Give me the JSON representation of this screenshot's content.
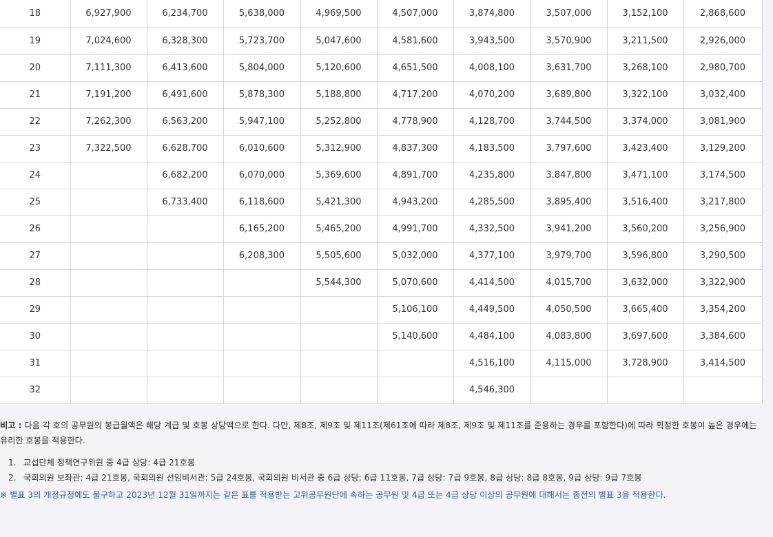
{
  "table": {
    "rows": [
      [
        "18",
        "6,927,900",
        "6,234,700",
        "5,638,000",
        "4,969,500",
        "4,507,000",
        "3,874,800",
        "3,507,000",
        "3,152,100",
        "2,868,600"
      ],
      [
        "19",
        "7,024,600",
        "6,328,300",
        "5,723,700",
        "5,047,600",
        "4,581,600",
        "3,943,500",
        "3,570,900",
        "3,211,500",
        "2,926,000"
      ],
      [
        "20",
        "7,111,300",
        "6,413,600",
        "5,804,000",
        "5,120,600",
        "4,651,500",
        "4,008,100",
        "3,631,700",
        "3,268,100",
        "2,980,700"
      ],
      [
        "21",
        "7,191,200",
        "6,491,600",
        "5,878,300",
        "5,188,800",
        "4,717,200",
        "4,070,200",
        "3,689,800",
        "3,322,100",
        "3,032,400"
      ],
      [
        "22",
        "7,262,300",
        "6,563,200",
        "5,947,100",
        "5,252,800",
        "4,778,900",
        "4,128,700",
        "3,744,500",
        "3,374,000",
        "3,081,900"
      ],
      [
        "23",
        "7,322,500",
        "6,628,700",
        "6,010,600",
        "5,312,900",
        "4,837,300",
        "4,183,500",
        "3,797,600",
        "3,423,400",
        "3,129,200"
      ],
      [
        "24",
        "",
        "6,682,200",
        "6,070,000",
        "5,369,600",
        "4,891,700",
        "4,235,800",
        "3,847,800",
        "3,471,100",
        "3,174,500"
      ],
      [
        "25",
        "",
        "6,733,400",
        "6,118,600",
        "5,421,300",
        "4,943,200",
        "4,285,500",
        "3,895,400",
        "3,516,400",
        "3,217,800"
      ],
      [
        "26",
        "",
        "",
        "6,165,200",
        "5,465,200",
        "4,991,700",
        "4,332,500",
        "3,941,200",
        "3,560,200",
        "3,256,900"
      ],
      [
        "27",
        "",
        "",
        "6,208,300",
        "5,505,600",
        "5,032,000",
        "4,377,100",
        "3,979,700",
        "3,596,800",
        "3,290,500"
      ],
      [
        "28",
        "",
        "",
        "",
        "5,544,300",
        "5,070,600",
        "4,414,500",
        "4,015,700",
        "3,632,000",
        "3,322,900"
      ],
      [
        "29",
        "",
        "",
        "",
        "",
        "5,106,100",
        "4,449,500",
        "4,050,500",
        "3,665,400",
        "3,354,200"
      ],
      [
        "30",
        "",
        "",
        "",
        "",
        "5,140,600",
        "4,484,100",
        "4,083,800",
        "3,697,600",
        "3,384,600"
      ],
      [
        "31",
        "",
        "",
        "",
        "",
        "",
        "4,516,100",
        "4,115,000",
        "3,728,900",
        "3,414,500"
      ],
      [
        "32",
        "",
        "",
        "",
        "",
        "",
        "4,546,300",
        "",
        "",
        ""
      ]
    ]
  },
  "notes": {
    "remark_label": "비고 :",
    "remark_text": " 다음 각 호의 공무원의 봉급월액은 해당 계급 및 호봉 상당액으로 한다. 다만, 제8조, 제9조 및 제11조(제61조에 따라 제8조, 제9조 및 제11조를 준용하는 경우를 포함한다)에 따라 획정한 호봉이 높은 경우에는 유리한 호봉을 적용한다.",
    "items": [
      {
        "num": "1.",
        "text": "교섭단체 정책연구위원 중 4급 상당: 4급 21호봉"
      },
      {
        "num": "2.",
        "text": "국회의원 보좌관: 4급 21호봉, 국회의원 선임비서관: 5급 24호봉, 국회의원 비서관 중 6급 상당: 6급 11호봉, 7급 상당: 7급 9호봉, 8급 상당: 8급 8호봉, 9급 상당: 9급 7호봉"
      }
    ],
    "star_note": "※ 별표 3의 개정규정에도 불구하고 2023년 12월 31일까지는 같은 표를 적용받는 고위공무원단에 속하는 공무원 및 4급 또는 4급 상당 이상의 공무원에 대해서는 종전의 별표 3을 적용한다."
  }
}
